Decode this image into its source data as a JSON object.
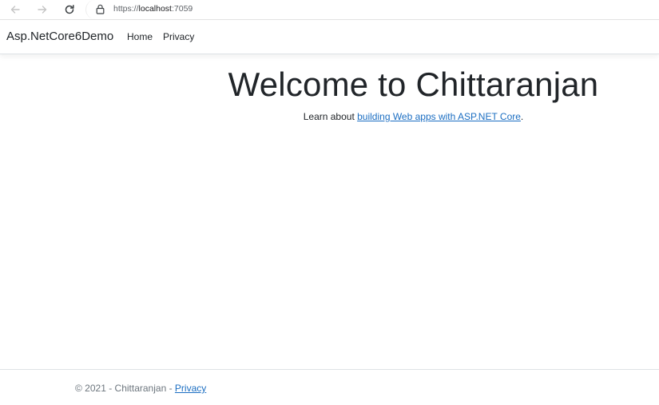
{
  "browser": {
    "url_scheme": "https://",
    "url_host": "localhost",
    "url_port": ":7059"
  },
  "navbar": {
    "brand": "Asp.NetCore6Demo",
    "links": [
      "Home",
      "Privacy"
    ]
  },
  "main": {
    "title": "Welcome to Chittaranjan",
    "learn_prefix": "Learn about ",
    "learn_link": "building Web apps with ASP.NET Core",
    "learn_suffix": "."
  },
  "footer": {
    "text": "© 2021 - Chittaranjan - ",
    "privacy_link": "Privacy"
  },
  "colors": {
    "link": "#1b6ec2",
    "text": "#212529",
    "muted": "#6c757d"
  },
  "icons": [
    "back-arrow-icon",
    "forward-arrow-icon",
    "reload-icon",
    "lock-icon"
  ]
}
